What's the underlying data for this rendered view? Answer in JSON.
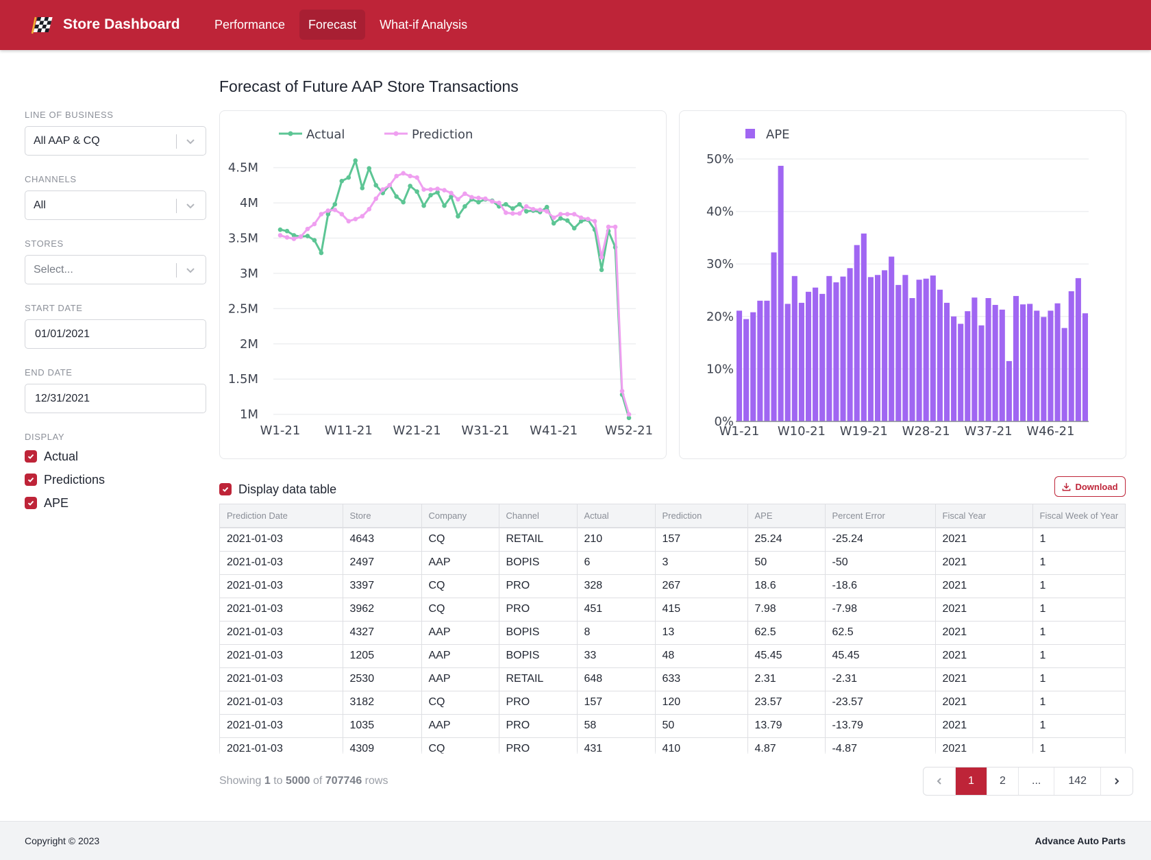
{
  "header": {
    "app_title": "Store Dashboard",
    "logo_icon": "checkered-flag-icon",
    "brand_color": "#be2438",
    "nav": [
      {
        "label": "Performance",
        "active": false
      },
      {
        "label": "Forecast",
        "active": true
      },
      {
        "label": "What-if Analysis",
        "active": false
      }
    ]
  },
  "sidebar": {
    "line_of_business": {
      "label": "LINE OF BUSINESS",
      "value": "All AAP & CQ"
    },
    "channels": {
      "label": "CHANNELS",
      "value": "All"
    },
    "stores": {
      "label": "STORES",
      "placeholder": "Select..."
    },
    "start_date": {
      "label": "START DATE",
      "value": "01/01/2021"
    },
    "end_date": {
      "label": "END DATE",
      "value": "12/31/2021"
    },
    "display": {
      "label": "DISPLAY",
      "options": [
        {
          "label": "Actual",
          "checked": true
        },
        {
          "label": "Predictions",
          "checked": true
        },
        {
          "label": "APE",
          "checked": true
        }
      ]
    }
  },
  "main": {
    "title": "Forecast of Future AAP Store Transactions",
    "display_table_label": "Display data table",
    "display_table_checked": true,
    "download_label": "Download",
    "table": {
      "columns": [
        "Prediction Date",
        "Store",
        "Company",
        "Channel",
        "Actual",
        "Prediction",
        "APE",
        "Percent Error",
        "Fiscal Year",
        "Fiscal Week of Year"
      ],
      "rows": [
        [
          "2021-01-03",
          "4643",
          "CQ",
          "RETAIL",
          "210",
          "157",
          "25.24",
          "-25.24",
          "2021",
          "1"
        ],
        [
          "2021-01-03",
          "2497",
          "AAP",
          "BOPIS",
          "6",
          "3",
          "50",
          "-50",
          "2021",
          "1"
        ],
        [
          "2021-01-03",
          "3397",
          "CQ",
          "PRO",
          "328",
          "267",
          "18.6",
          "-18.6",
          "2021",
          "1"
        ],
        [
          "2021-01-03",
          "3962",
          "CQ",
          "PRO",
          "451",
          "415",
          "7.98",
          "-7.98",
          "2021",
          "1"
        ],
        [
          "2021-01-03",
          "4327",
          "AAP",
          "BOPIS",
          "8",
          "13",
          "62.5",
          "62.5",
          "2021",
          "1"
        ],
        [
          "2021-01-03",
          "1205",
          "AAP",
          "BOPIS",
          "33",
          "48",
          "45.45",
          "45.45",
          "2021",
          "1"
        ],
        [
          "2021-01-03",
          "2530",
          "AAP",
          "RETAIL",
          "648",
          "633",
          "2.31",
          "-2.31",
          "2021",
          "1"
        ],
        [
          "2021-01-03",
          "3182",
          "CQ",
          "PRO",
          "157",
          "120",
          "23.57",
          "-23.57",
          "2021",
          "1"
        ],
        [
          "2021-01-03",
          "1035",
          "AAP",
          "PRO",
          "58",
          "50",
          "13.79",
          "-13.79",
          "2021",
          "1"
        ],
        [
          "2021-01-03",
          "4309",
          "CQ",
          "PRO",
          "431",
          "410",
          "4.87",
          "-4.87",
          "2021",
          "1"
        ]
      ]
    },
    "rows_info": {
      "prefix": "Showing",
      "from": "1",
      "to_word": "to",
      "to": "5000",
      "of_word": "of",
      "total": "707746",
      "suffix": "rows"
    },
    "pagination": {
      "pages": [
        "1",
        "2",
        "...",
        "142"
      ],
      "active": "1",
      "prev_icon": "chevron-left-icon",
      "next_icon": "chevron-right-icon"
    }
  },
  "footer": {
    "copyright": "Copyright © 2023",
    "company": "Advance Auto Parts"
  },
  "chart_data": [
    {
      "type": "line",
      "title": "",
      "xlabel": "",
      "ylabel": "",
      "grid": true,
      "legend": "top-left",
      "x_ticks": [
        "W1-21",
        "W11-21",
        "W21-21",
        "W31-21",
        "W41-21",
        "W52-21"
      ],
      "y_ticks": [
        "1M",
        "1.5M",
        "2M",
        "2.5M",
        "3M",
        "3.5M",
        "4M",
        "4.5M"
      ],
      "y_tick_values": [
        1.0,
        1.5,
        2.0,
        2.5,
        3.0,
        3.5,
        4.0,
        4.5
      ],
      "ylim": [
        0.88,
        4.72
      ],
      "y_unit": "millions",
      "x": [
        "W1-21",
        "W2-21",
        "W3-21",
        "W4-21",
        "W5-21",
        "W6-21",
        "W7-21",
        "W8-21",
        "W9-21",
        "W10-21",
        "W11-21",
        "W12-21",
        "W13-21",
        "W14-21",
        "W15-21",
        "W16-21",
        "W17-21",
        "W18-21",
        "W19-21",
        "W20-21",
        "W21-21",
        "W22-21",
        "W23-21",
        "W24-21",
        "W25-21",
        "W26-21",
        "W27-21",
        "W28-21",
        "W29-21",
        "W30-21",
        "W31-21",
        "W32-21",
        "W33-21",
        "W34-21",
        "W35-21",
        "W36-21",
        "W37-21",
        "W38-21",
        "W39-21",
        "W40-21",
        "W41-21",
        "W42-21",
        "W43-21",
        "W44-21",
        "W45-21",
        "W46-21",
        "W47-21",
        "W48-21",
        "W49-21",
        "W50-21",
        "W51-21",
        "W52-21"
      ],
      "series": [
        {
          "name": "Actual",
          "color": "#5cc594",
          "values": [
            3.62,
            3.6,
            3.54,
            3.52,
            3.53,
            3.47,
            3.29,
            3.84,
            3.98,
            4.31,
            4.36,
            4.6,
            4.21,
            4.49,
            4.25,
            4.14,
            4.25,
            4.09,
            4.01,
            4.24,
            4.16,
            3.96,
            4.11,
            4.15,
            3.96,
            4.09,
            3.81,
            3.95,
            4.05,
            4.01,
            4.05,
            4.03,
            3.95,
            3.98,
            3.92,
            3.98,
            3.88,
            3.89,
            3.87,
            3.94,
            3.71,
            3.78,
            3.75,
            3.64,
            3.74,
            3.76,
            3.62,
            3.05,
            3.6,
            3.37,
            1.28,
            0.95
          ]
        },
        {
          "name": "Prediction",
          "color": "#ef9ff0",
          "values": [
            3.54,
            3.51,
            3.49,
            3.52,
            3.63,
            3.7,
            3.84,
            3.89,
            3.9,
            3.84,
            3.74,
            3.77,
            3.81,
            3.91,
            4.06,
            4.19,
            4.25,
            4.38,
            4.42,
            4.38,
            4.36,
            4.19,
            4.19,
            4.2,
            4.18,
            4.14,
            4.05,
            4.13,
            4.08,
            4.07,
            4.06,
            4.02,
            4.0,
            3.86,
            3.85,
            3.85,
            3.95,
            3.91,
            3.9,
            3.88,
            3.79,
            3.84,
            3.84,
            3.84,
            3.79,
            3.77,
            3.74,
            3.23,
            3.66,
            3.66,
            1.33,
            1.0
          ]
        }
      ]
    },
    {
      "type": "bar",
      "title": "",
      "xlabel": "",
      "ylabel": "",
      "grid": true,
      "legend": "top-left",
      "x_ticks": [
        "W1-21",
        "W10-21",
        "W19-21",
        "W28-21",
        "W37-21",
        "W46-21"
      ],
      "y_ticks": [
        "0%",
        "10%",
        "20%",
        "30%",
        "40%",
        "50%"
      ],
      "y_tick_values": [
        0,
        10,
        20,
        30,
        40,
        50
      ],
      "ylim": [
        0,
        50
      ],
      "categories": [
        "W1-21",
        "W2-21",
        "W3-21",
        "W4-21",
        "W5-21",
        "W6-21",
        "W7-21",
        "W8-21",
        "W9-21",
        "W10-21",
        "W11-21",
        "W12-21",
        "W13-21",
        "W14-21",
        "W15-21",
        "W16-21",
        "W17-21",
        "W18-21",
        "W19-21",
        "W20-21",
        "W21-21",
        "W22-21",
        "W23-21",
        "W24-21",
        "W25-21",
        "W26-21",
        "W27-21",
        "W28-21",
        "W29-21",
        "W30-21",
        "W31-21",
        "W32-21",
        "W33-21",
        "W34-21",
        "W35-21",
        "W36-21",
        "W37-21",
        "W38-21",
        "W39-21",
        "W40-21",
        "W41-21",
        "W42-21",
        "W43-21",
        "W44-21",
        "W45-21",
        "W46-21",
        "W47-21",
        "W48-21",
        "W49-21",
        "W50-21",
        "W51-21"
      ],
      "series": [
        {
          "name": "APE",
          "color": "#a066f2",
          "values": [
            21.1,
            19.5,
            20.8,
            23.0,
            23.0,
            32.2,
            48.7,
            22.4,
            27.7,
            22.6,
            24.7,
            25.5,
            24.3,
            27.7,
            26.5,
            27.6,
            29.2,
            33.6,
            35.8,
            27.5,
            27.9,
            28.8,
            31.4,
            26.0,
            27.9,
            23.5,
            27.0,
            27.2,
            27.8,
            25.1,
            22.6,
            20.0,
            18.6,
            21.0,
            23.6,
            18.3,
            23.5,
            22.2,
            21.3,
            11.5,
            23.9,
            22.3,
            22.4,
            21.1,
            19.9,
            21.1,
            22.5,
            17.8,
            24.8,
            27.3,
            20.6
          ]
        }
      ]
    }
  ]
}
